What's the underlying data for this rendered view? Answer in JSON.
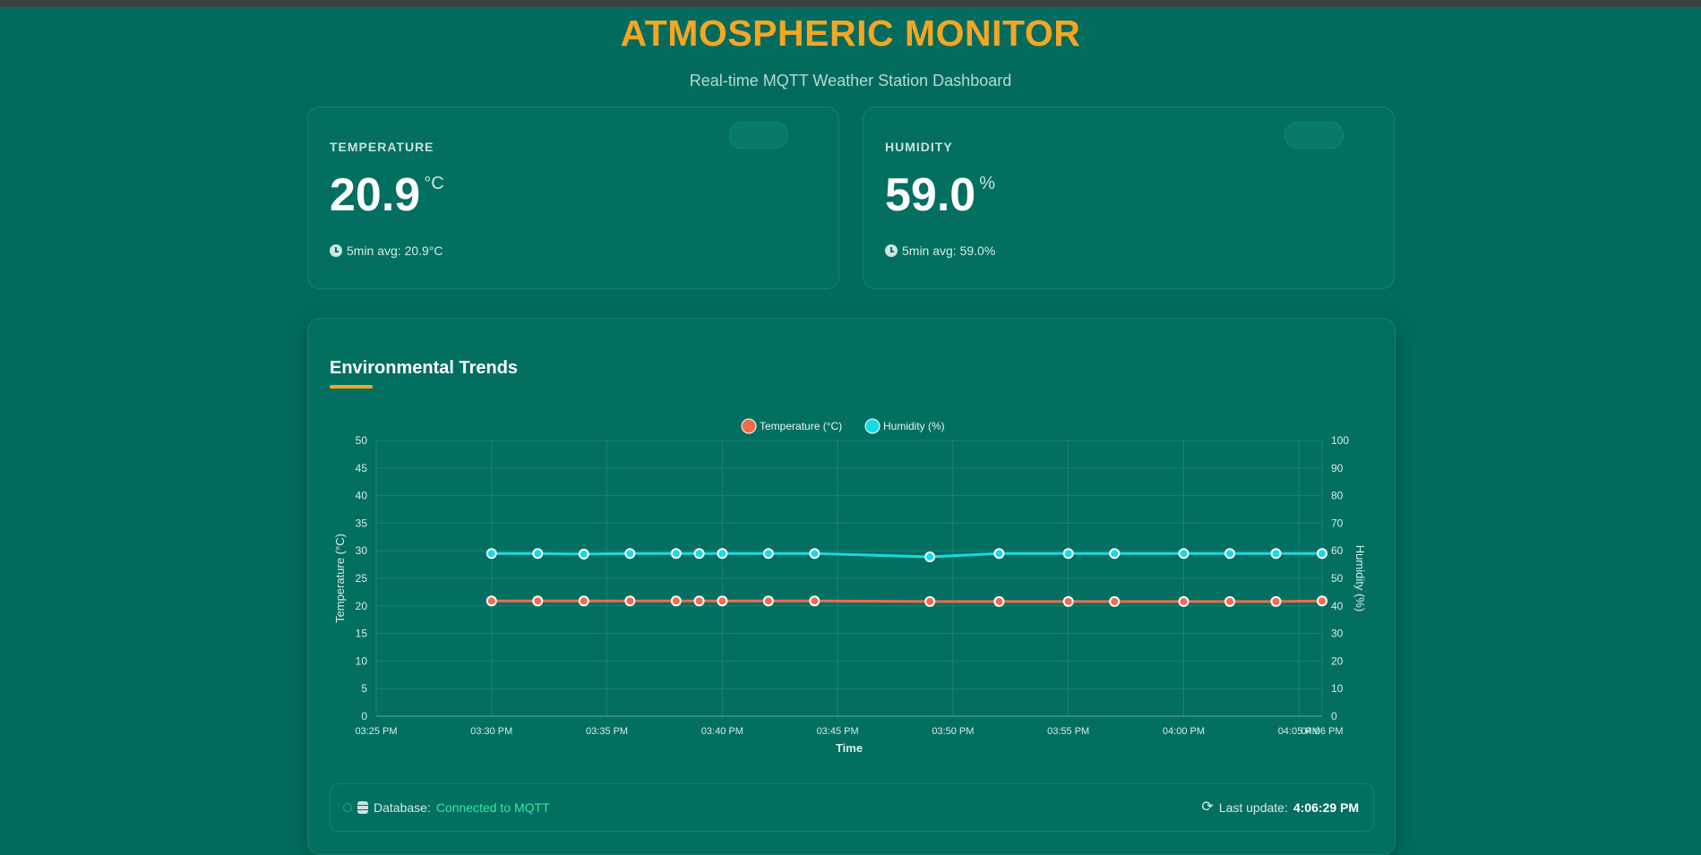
{
  "header": {
    "title": "ATMOSPHERIC MONITOR",
    "subtitle": "Real-time MQTT Weather Station Dashboard"
  },
  "cards": {
    "temperature": {
      "label": "TEMPERATURE",
      "value": "20.9",
      "unit": "°C",
      "avg": "5min avg: 20.9°C"
    },
    "humidity": {
      "label": "HUMIDITY",
      "value": "59.0",
      "unit": "%",
      "avg": "5min avg: 59.0%"
    }
  },
  "trends": {
    "title": "Environmental Trends"
  },
  "status": {
    "db_label": "Database:",
    "db_value": "Connected to MQTT",
    "update_label": "Last update:",
    "update_value": "4:06:29 PM"
  },
  "colors": {
    "temperature": "#f26b4f",
    "humidity": "#19d9e3",
    "accent": "#f5a623"
  },
  "chart_data": {
    "type": "line",
    "title": "",
    "xlabel": "Time",
    "ylabel": "Temperature (°C)",
    "y2label": "Humidity (%)",
    "ylim": [
      0,
      50
    ],
    "y2lim": [
      0,
      100
    ],
    "xlim": [
      "03:25 PM",
      "04:06 PM"
    ],
    "x_ticks": [
      "03:25 PM",
      "03:30 PM",
      "03:35 PM",
      "03:40 PM",
      "03:45 PM",
      "03:50 PM",
      "03:55 PM",
      "04:00 PM",
      "04:05 PM",
      "04:06 PM"
    ],
    "y_ticks": [
      0,
      5,
      10,
      15,
      20,
      25,
      30,
      35,
      40,
      45,
      50
    ],
    "y2_ticks": [
      0,
      10,
      20,
      30,
      40,
      50,
      60,
      70,
      80,
      90,
      100
    ],
    "grid": true,
    "legend": "top-center",
    "series": [
      {
        "name": "Temperature (°C)",
        "axis": "left",
        "color": "#f26b4f",
        "x": [
          "03:30 PM",
          "03:32 PM",
          "03:34 PM",
          "03:36 PM",
          "03:38 PM",
          "03:39 PM",
          "03:40 PM",
          "03:42 PM",
          "03:44 PM",
          "03:49 PM",
          "03:52 PM",
          "03:55 PM",
          "03:57 PM",
          "04:00 PM",
          "04:02 PM",
          "04:04 PM",
          "04:06 PM"
        ],
        "values": [
          20.9,
          20.9,
          20.9,
          20.9,
          20.9,
          20.9,
          20.9,
          20.9,
          20.9,
          20.8,
          20.8,
          20.8,
          20.8,
          20.8,
          20.8,
          20.8,
          20.9
        ]
      },
      {
        "name": "Humidity (%)",
        "axis": "right",
        "color": "#19d9e3",
        "x": [
          "03:30 PM",
          "03:32 PM",
          "03:34 PM",
          "03:36 PM",
          "03:38 PM",
          "03:39 PM",
          "03:40 PM",
          "03:42 PM",
          "03:44 PM",
          "03:49 PM",
          "03:52 PM",
          "03:55 PM",
          "03:57 PM",
          "04:00 PM",
          "04:02 PM",
          "04:04 PM",
          "04:06 PM"
        ],
        "values": [
          59.0,
          59.0,
          58.8,
          59.0,
          59.0,
          59.0,
          59.0,
          59.0,
          59.0,
          57.8,
          59.0,
          59.0,
          59.0,
          59.0,
          59.0,
          59.0,
          59.0
        ]
      }
    ]
  }
}
